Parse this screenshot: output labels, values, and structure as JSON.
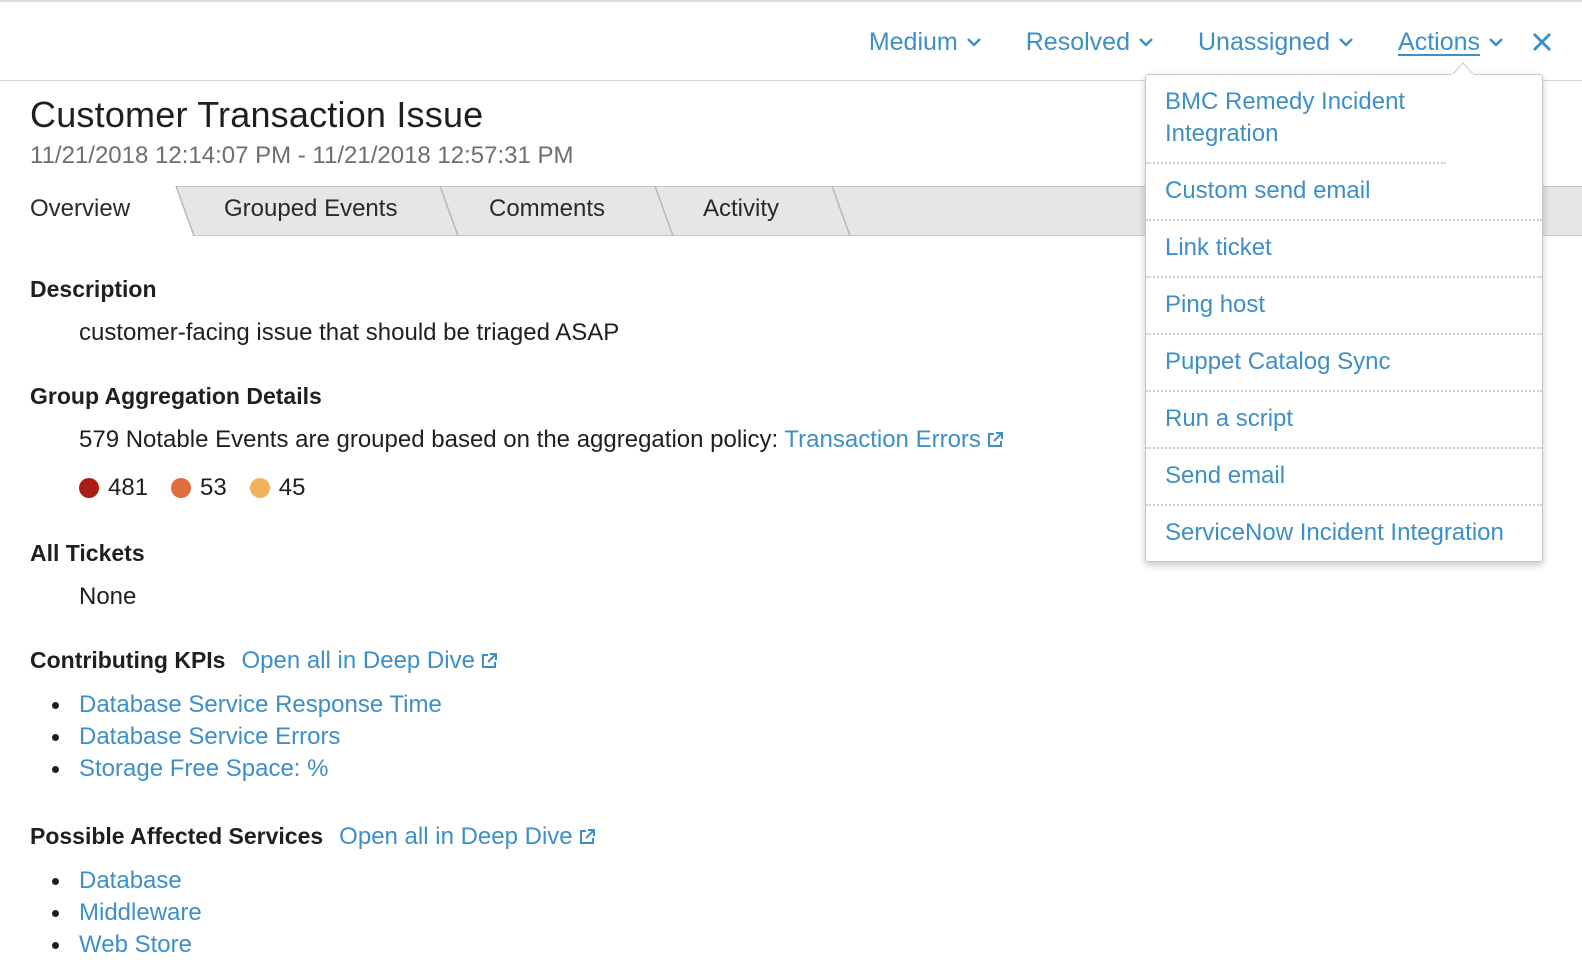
{
  "top_bar": {
    "severity": "Medium",
    "status": "Resolved",
    "owner": "Unassigned",
    "actions": "Actions"
  },
  "episode": {
    "title": "Customer Transaction Issue",
    "time_range": "11/21/2018 12:14:07 PM - 11/21/2018 12:57:31 PM"
  },
  "tabs": [
    "Overview",
    "Grouped Events",
    "Comments",
    "Activity"
  ],
  "description": {
    "heading": "Description",
    "text": "customer-facing issue that should be triaged ASAP"
  },
  "group_aggregation": {
    "heading": "Group Aggregation Details",
    "text": "579 Notable Events are grouped based on the aggregation policy:",
    "policy_link": "Transaction Errors",
    "counts": [
      {
        "value": "481",
        "color": "#a81c13"
      },
      {
        "value": "53",
        "color": "#e06b3c"
      },
      {
        "value": "45",
        "color": "#f1b25b"
      }
    ]
  },
  "tickets": {
    "heading": "All Tickets",
    "value": "None"
  },
  "kpis": {
    "heading": "Contributing KPIs",
    "link": "Open all in Deep Dive",
    "items": [
      "Database Service Response Time",
      "Database Service Errors",
      "Storage Free Space: %"
    ]
  },
  "services": {
    "heading": "Possible Affected Services",
    "link": "Open all in Deep Dive",
    "items": [
      "Database",
      "Middleware",
      "Web Store"
    ]
  },
  "actions_menu": {
    "items": [
      "BMC Remedy Incident Integration",
      "Custom send email",
      "Link ticket",
      "Ping host",
      "Puppet Catalog Sync",
      "Run a script",
      "Send email",
      "ServiceNow Incident Integration"
    ]
  },
  "colors": {
    "link": "#3d8fc6",
    "text": "#1f1f1f",
    "muted": "#6e6e6e"
  }
}
